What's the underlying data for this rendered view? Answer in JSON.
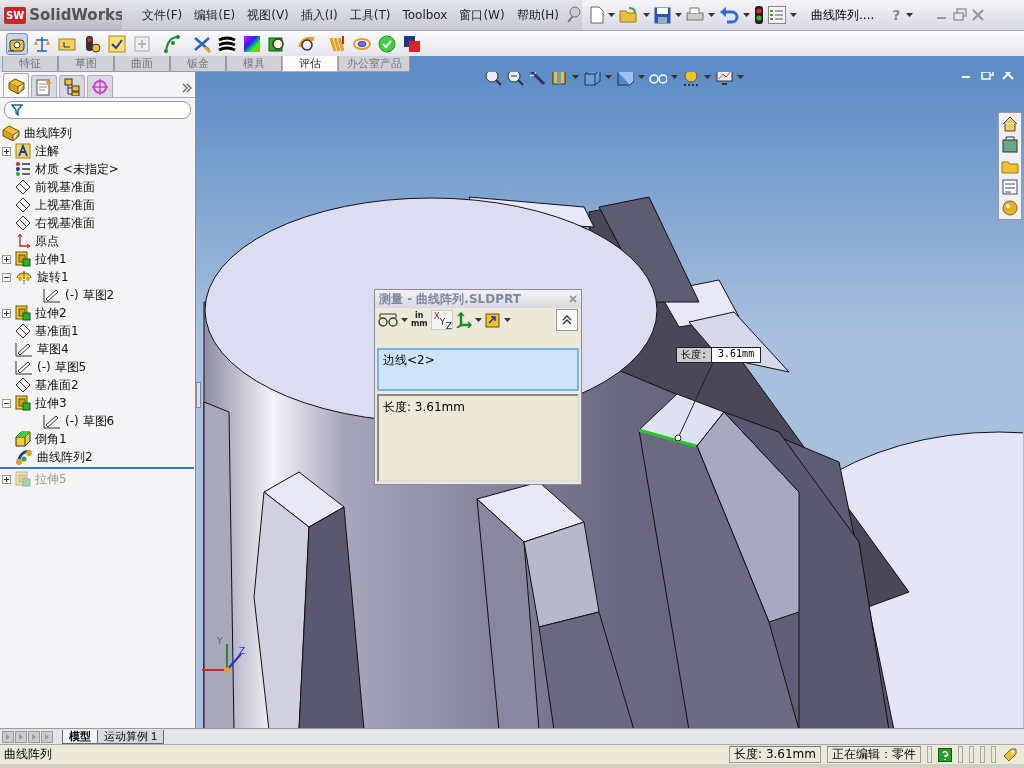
{
  "app": {
    "logo_badge": "SW",
    "logo": "SolidWorks",
    "document_title": "曲线阵列....",
    "help_glyph": "?"
  },
  "menu": [
    "文件(F)",
    "编辑(E)",
    "视图(V)",
    "插入(I)",
    "工具(T)",
    "Toolbox",
    "窗口(W)",
    "帮助(H)"
  ],
  "toolbar": {
    "measure_active": true
  },
  "command_tabs": [
    {
      "label": "特征",
      "selected": false
    },
    {
      "label": "草图",
      "selected": false
    },
    {
      "label": "曲面",
      "selected": false
    },
    {
      "label": "钣金",
      "selected": false
    },
    {
      "label": "模具",
      "selected": false
    },
    {
      "label": "评估",
      "selected": true
    },
    {
      "label": "办公室产品",
      "selected": false
    }
  ],
  "panel_tabs": [
    {
      "selected": true
    },
    {
      "selected": false
    },
    {
      "selected": false
    },
    {
      "selected": false
    }
  ],
  "tree": {
    "root": "曲线阵列",
    "items": [
      {
        "label": "注解",
        "kind": "annotation",
        "expandable": true,
        "expanded": false,
        "rolled_back": false
      },
      {
        "label": "材质 <未指定>",
        "kind": "material",
        "expandable": false,
        "rolled_back": false
      },
      {
        "label": "前视基准面",
        "kind": "plane",
        "expandable": false,
        "rolled_back": false
      },
      {
        "label": "上视基准面",
        "kind": "plane",
        "expandable": false,
        "rolled_back": false
      },
      {
        "label": "右视基准面",
        "kind": "plane",
        "expandable": false,
        "rolled_back": false
      },
      {
        "label": "原点",
        "kind": "origin",
        "expandable": false,
        "rolled_back": false
      },
      {
        "label": "拉伸1",
        "kind": "extrude",
        "expandable": true,
        "expanded": false,
        "rolled_back": false
      },
      {
        "label": "旋转1",
        "kind": "revolve",
        "expandable": true,
        "expanded": true,
        "rolled_back": false,
        "children": [
          {
            "label": "(-) 草图2",
            "kind": "sketch",
            "expandable": false,
            "rolled_back": false
          }
        ]
      },
      {
        "label": "拉伸2",
        "kind": "extrude",
        "expandable": true,
        "expanded": false,
        "rolled_back": false
      },
      {
        "label": "基准面1",
        "kind": "plane",
        "expandable": false,
        "rolled_back": false
      },
      {
        "label": "草图4",
        "kind": "sketch",
        "expandable": false,
        "rolled_back": false
      },
      {
        "label": "(-) 草图5",
        "kind": "sketch",
        "expandable": false,
        "rolled_back": false
      },
      {
        "label": "基准面2",
        "kind": "plane",
        "expandable": false,
        "rolled_back": false
      },
      {
        "label": "拉伸3",
        "kind": "extrude",
        "expandable": true,
        "expanded": true,
        "rolled_back": false,
        "children": [
          {
            "label": "(-) 草图6",
            "kind": "sketch",
            "expandable": false,
            "rolled_back": false
          }
        ]
      },
      {
        "label": "倒角1",
        "kind": "chamfer",
        "expandable": false,
        "rolled_back": false
      },
      {
        "label": "曲线阵列2",
        "kind": "pattern",
        "expandable": false,
        "rolled_back": false
      },
      {
        "label": "拉伸5",
        "kind": "extrude",
        "expandable": true,
        "expanded": false,
        "rolled_back": true
      }
    ]
  },
  "measure": {
    "title": "测量 - 曲线阵列.SLDPRT",
    "units_top": "in",
    "units_bottom": "mm",
    "xyz": [
      "X",
      "Y",
      "Z"
    ],
    "selection": "边线<2>",
    "result": "长度: 3.61mm"
  },
  "callout": {
    "label": "长度:",
    "value": "3.61mm"
  },
  "triad": [
    "Y",
    "Z"
  ],
  "bottom_tabs": [
    {
      "label": "模型",
      "selected": true
    },
    {
      "label": "运动算例 1",
      "selected": false
    }
  ],
  "status_bar": {
    "message": "曲线阵列",
    "measurement": "长度: 3.61mm",
    "mode": "正在编辑：零件"
  }
}
